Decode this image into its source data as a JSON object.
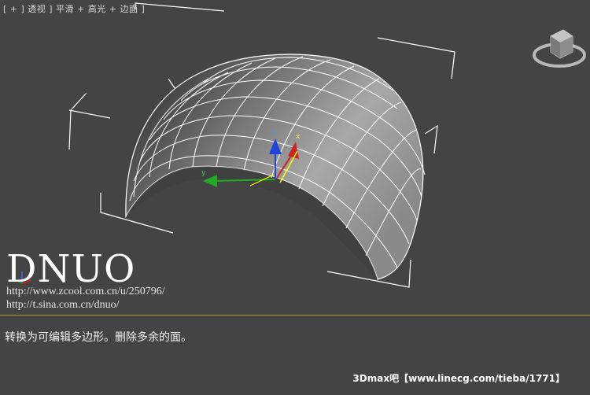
{
  "viewport": {
    "label": "[ + ] 透视 ] 平滑 + 高光 + 边面 ]",
    "gizmo_labels": {
      "x": "x",
      "y": "y",
      "z": "z"
    }
  },
  "watermark": {
    "brand": "DNUO",
    "url1": "http://www.zcool.com.cn/u/250796/",
    "url2": "http://t.sina.com.cn/dnuo/"
  },
  "caption": "转换为可编辑多边形。删除多余的面。",
  "footer": "3Dmax吧【www.linecg.com/tieba/1771】",
  "colors": {
    "background": "#444444",
    "divider": "#b8902e",
    "axis_x": "#cc2222",
    "axis_y": "#22aa22",
    "axis_z": "#2244dd",
    "selection": "#ffff00"
  },
  "icons": {
    "viewcube": "viewcube-icon"
  }
}
